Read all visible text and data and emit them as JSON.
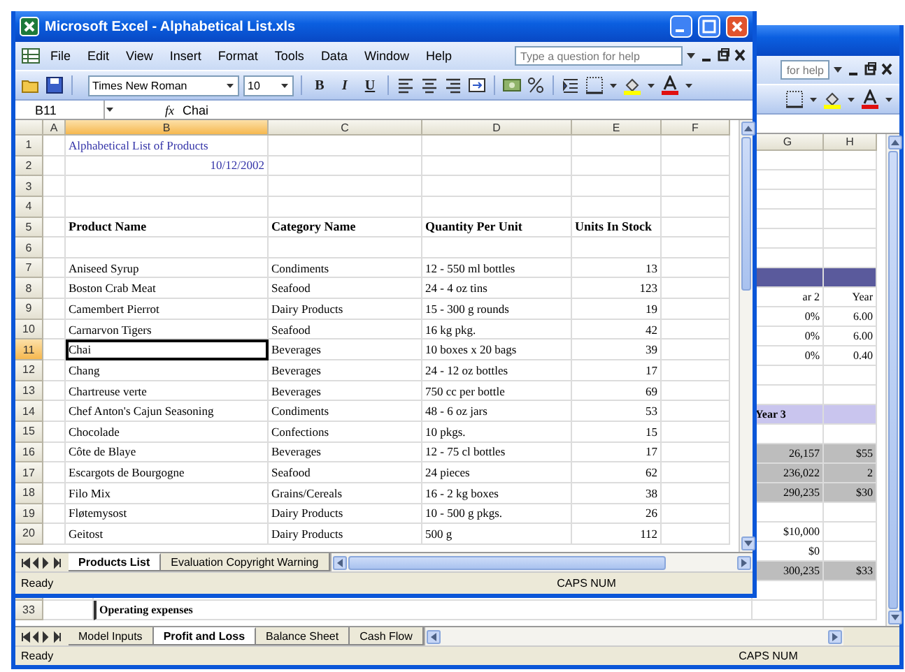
{
  "back_window": {
    "help_placeholder": "for help",
    "columns": [
      "G",
      "H"
    ],
    "rows": [
      {
        "kind": "blank"
      },
      {
        "kind": "blank"
      },
      {
        "kind": "blank"
      },
      {
        "kind": "blank"
      },
      {
        "kind": "blank"
      },
      {
        "kind": "blank"
      },
      {
        "kind": "band"
      },
      {
        "kind": "text",
        "g": "ar 2",
        "h": "Year"
      },
      {
        "kind": "text",
        "g": "0%",
        "h": "6.00"
      },
      {
        "kind": "text",
        "g": "0%",
        "h": "6.00"
      },
      {
        "kind": "text",
        "g": "0%",
        "h": "0.40"
      },
      {
        "kind": "blank"
      },
      {
        "kind": "blank"
      },
      {
        "kind": "heading",
        "g": "Year 3"
      },
      {
        "kind": "blank"
      },
      {
        "kind": "shaded",
        "g": "26,157",
        "h": "$55"
      },
      {
        "kind": "shaded",
        "g": "236,022",
        "h": "2"
      },
      {
        "kind": "shaded",
        "g": "290,235",
        "h": "$30"
      },
      {
        "kind": "blank"
      },
      {
        "kind": "text",
        "g": "$10,000"
      },
      {
        "kind": "text",
        "g": "$0"
      },
      {
        "kind": "shaded",
        "g": "300,235",
        "h": "$33"
      },
      {
        "kind": "blank"
      },
      {
        "kind": "label",
        "num": "33",
        "label": "Operating expenses"
      }
    ],
    "sheet_tabs": [
      {
        "label": "Model Inputs",
        "selected": false
      },
      {
        "label": "Profit and Loss",
        "selected": true
      },
      {
        "label": "Balance Sheet",
        "selected": false
      },
      {
        "label": "Cash Flow",
        "selected": false
      }
    ],
    "status": "Ready",
    "indicators": "CAPS NUM"
  },
  "front_window": {
    "title": "Microsoft Excel - Alphabetical List.xls",
    "menus": [
      "File",
      "Edit",
      "View",
      "Insert",
      "Format",
      "Tools",
      "Data",
      "Window",
      "Help"
    ],
    "help_placeholder": "Type a question for help",
    "font": "Times New Roman",
    "size": "10",
    "style_buttons": [
      "B",
      "I",
      "U"
    ],
    "name_box": "B11",
    "fx": "fx",
    "formula": "Chai",
    "columns": [
      {
        "label": "A",
        "selected": false
      },
      {
        "label": "B",
        "selected": true
      },
      {
        "label": "C",
        "selected": false
      },
      {
        "label": "D",
        "selected": false
      },
      {
        "label": "E",
        "selected": false
      },
      {
        "label": "F",
        "selected": false
      }
    ],
    "rows": [
      {
        "num": "1",
        "kind": "title",
        "selected": false,
        "b": "Alphabetical List of Products"
      },
      {
        "num": "2",
        "kind": "date",
        "selected": false,
        "b": "10/12/2002"
      },
      {
        "num": "3",
        "kind": "blank",
        "selected": false
      },
      {
        "num": "4",
        "kind": "blank",
        "selected": false
      },
      {
        "num": "5",
        "kind": "header",
        "selected": false,
        "b": "Product Name",
        "c": "Category Name",
        "d": "Quantity Per Unit",
        "e": "Units In Stock"
      },
      {
        "num": "6",
        "kind": "blank",
        "selected": false
      },
      {
        "num": "7",
        "kind": "data",
        "selected": false,
        "b": "Aniseed Syrup",
        "c": "Condiments",
        "d": "12 - 550 ml bottles",
        "e": "13"
      },
      {
        "num": "8",
        "kind": "data",
        "selected": false,
        "b": "Boston Crab Meat",
        "c": "Seafood",
        "d": "24 - 4 oz tins",
        "e": "123"
      },
      {
        "num": "9",
        "kind": "data",
        "selected": false,
        "b": "Camembert Pierrot",
        "c": "Dairy Products",
        "d": "15 - 300 g rounds",
        "e": "19"
      },
      {
        "num": "10",
        "kind": "data",
        "selected": false,
        "b": "Carnarvon Tigers",
        "c": "Seafood",
        "d": "16 kg pkg.",
        "e": "42"
      },
      {
        "num": "11",
        "kind": "data",
        "selected": true,
        "b": "Chai",
        "c": "Beverages",
        "d": "10 boxes x 20 bags",
        "e": "39"
      },
      {
        "num": "12",
        "kind": "data",
        "selected": false,
        "b": "Chang",
        "c": "Beverages",
        "d": "24 - 12 oz bottles",
        "e": "17"
      },
      {
        "num": "13",
        "kind": "data",
        "selected": false,
        "b": "Chartreuse verte",
        "c": "Beverages",
        "d": "750 cc per bottle",
        "e": "69"
      },
      {
        "num": "14",
        "kind": "data",
        "selected": false,
        "b": "Chef Anton's Cajun Seasoning",
        "c": "Condiments",
        "d": "48 - 6 oz jars",
        "e": "53"
      },
      {
        "num": "15",
        "kind": "data",
        "selected": false,
        "b": "Chocolade",
        "c": "Confections",
        "d": "10 pkgs.",
        "e": "15"
      },
      {
        "num": "16",
        "kind": "data",
        "selected": false,
        "b": "Côte de Blaye",
        "c": "Beverages",
        "d": "12 - 75 cl bottles",
        "e": "17"
      },
      {
        "num": "17",
        "kind": "data",
        "selected": false,
        "b": "Escargots de Bourgogne",
        "c": "Seafood",
        "d": "24 pieces",
        "e": "62"
      },
      {
        "num": "18",
        "kind": "data",
        "selected": false,
        "b": "Filo Mix",
        "c": "Grains/Cereals",
        "d": "16 - 2 kg boxes",
        "e": "38"
      },
      {
        "num": "19",
        "kind": "data",
        "selected": false,
        "b": "Fløtemysost",
        "c": "Dairy Products",
        "d": "10 - 500 g pkgs.",
        "e": "26"
      },
      {
        "num": "20",
        "kind": "data",
        "selected": false,
        "b": "Geitost",
        "c": "Dairy Products",
        "d": "500 g",
        "e": "112"
      }
    ],
    "sheet_tabs": [
      {
        "label": "Products List",
        "selected": true
      },
      {
        "label": "Evaluation Copyright Warning",
        "selected": false
      }
    ],
    "status": "Ready",
    "indicators": "CAPS NUM"
  }
}
